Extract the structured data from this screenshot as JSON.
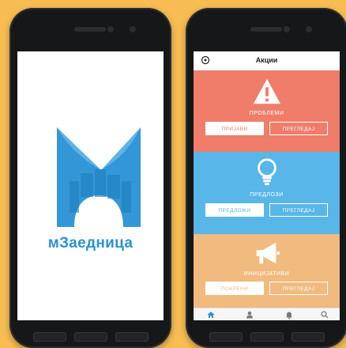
{
  "left_phone": {
    "app_name": "мЗаедница",
    "logo_colors": {
      "primary": "#2b92d3",
      "light": "#5fb2e6"
    }
  },
  "right_phone": {
    "header": {
      "title": "Акции",
      "icon": "settings-icon"
    },
    "sections": [
      {
        "id": "problems",
        "title": "ПРОБЛЕМИ",
        "icon": "warning-icon",
        "color": "#ef7d69",
        "buttons": [
          {
            "label": "ПРИЈАВИ",
            "style": "solid"
          },
          {
            "label": "ПРЕГЛЕДАЈ",
            "style": "outline"
          }
        ]
      },
      {
        "id": "proposals",
        "title": "ПРЕДЛОЗИ",
        "icon": "lightbulb-icon",
        "color": "#59b6e8",
        "buttons": [
          {
            "label": "ПРЕДЛОЖИ",
            "style": "solid"
          },
          {
            "label": "ПРЕГЛЕДАЈ",
            "style": "outline"
          }
        ]
      },
      {
        "id": "initiatives",
        "title": "ИНИЦИЈАТИВИ",
        "icon": "megaphone-icon",
        "color": "#f1ba7f",
        "buttons": [
          {
            "label": "ПОКРЕНИ",
            "style": "solid"
          },
          {
            "label": "ПРЕГЛЕДАЈ",
            "style": "outline"
          }
        ]
      }
    ],
    "tabs": [
      {
        "name": "home",
        "icon": "home-icon",
        "active": true
      },
      {
        "name": "profile",
        "icon": "user-icon",
        "active": false
      },
      {
        "name": "notifications",
        "icon": "bell-icon",
        "active": false
      },
      {
        "name": "search",
        "icon": "search-icon",
        "active": false
      }
    ],
    "accent_color": "#2b92d3"
  }
}
